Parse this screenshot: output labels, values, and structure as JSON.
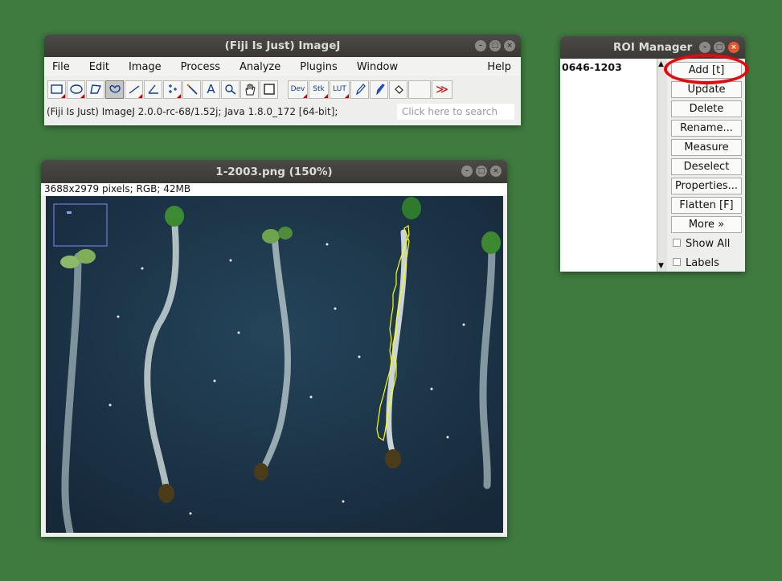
{
  "imagej": {
    "title": "(Fiji Is Just) ImageJ",
    "menu": [
      "File",
      "Edit",
      "Image",
      "Process",
      "Analyze",
      "Plugins",
      "Window"
    ],
    "help": "Help",
    "tools": {
      "dev": "Dev",
      "stk": "Stk",
      "lut": "LUT",
      "text": "A",
      "more": "≫"
    },
    "status": "(Fiji Is Just) ImageJ 2.0.0-rc-68/1.52j; Java 1.8.0_172 [64-bit];",
    "search_placeholder": "Click here to search"
  },
  "image_window": {
    "title": "1-2003.png (150%)",
    "info": "3688x2979 pixels; RGB; 42MB"
  },
  "roi_manager": {
    "title": "ROI Manager",
    "items": [
      "0646-1203"
    ],
    "buttons": [
      "Add [t]",
      "Update",
      "Delete",
      "Rename...",
      "Measure",
      "Deselect",
      "Properties...",
      "Flatten [F]",
      "More »"
    ],
    "checkboxes": [
      "Show All",
      "Labels"
    ]
  },
  "colors": {
    "desktop": "#3f7a3f",
    "highlight": "#e8070b",
    "roi_outline": "#ffff00"
  }
}
